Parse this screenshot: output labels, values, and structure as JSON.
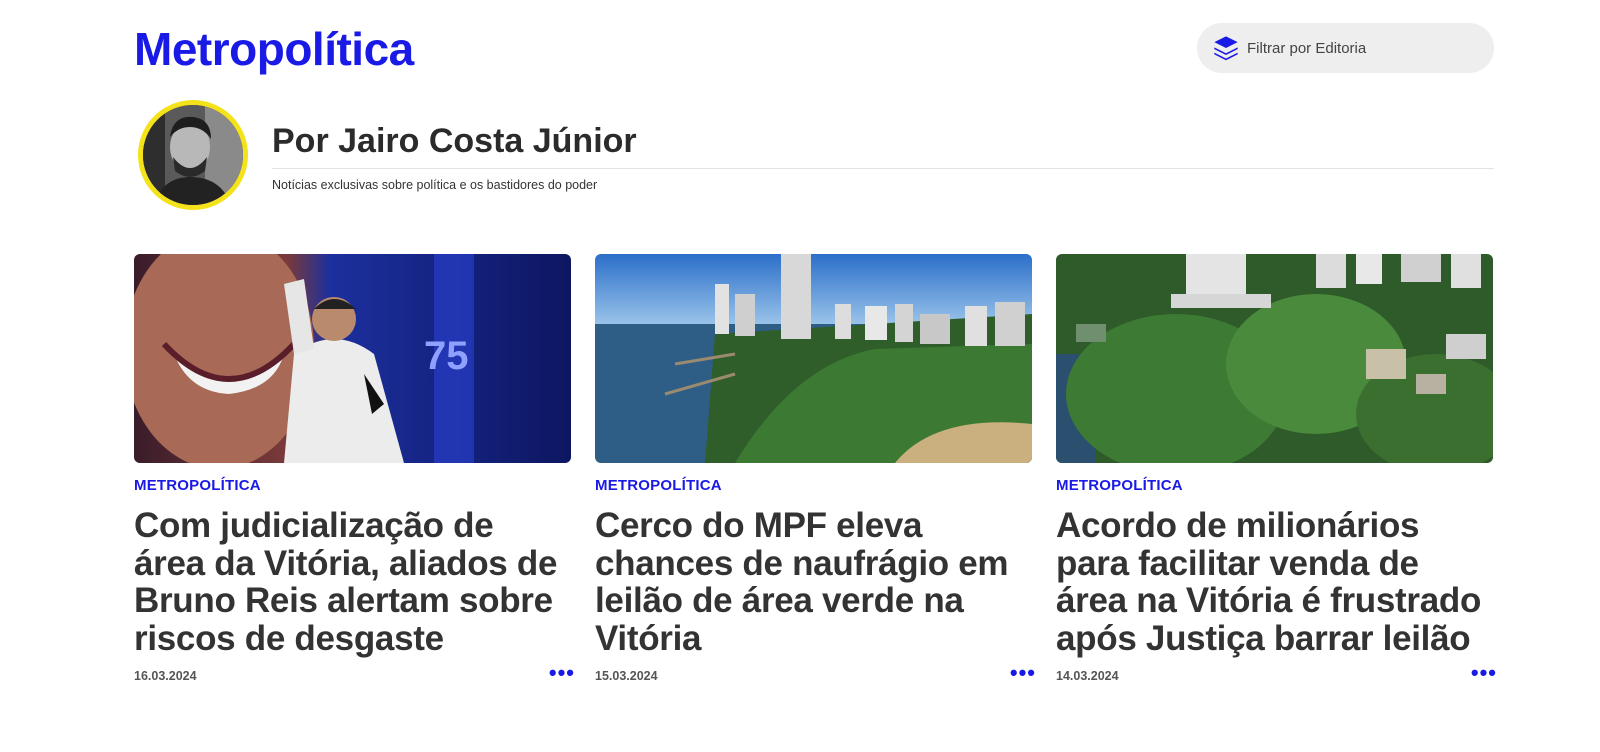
{
  "header": {
    "brand": "Metropolítica",
    "filter_label": "Filtrar por Editoria",
    "filter_icon": "layers-icon"
  },
  "author": {
    "name": "Por Jairo Costa Júnior",
    "description": "Notícias exclusivas sobre política e os bastidores do poder"
  },
  "articles": [
    {
      "category": "METROPOLÍTICA",
      "title": "Com judicialização de área da Vitória, aliados de Bruno Reis alertam sobre riscos de desgaste",
      "date": "16.03.2024",
      "more": "•••"
    },
    {
      "category": "METROPOLÍTICA",
      "title": "Cerco do MPF eleva chances de naufrágio em leilão de área verde na Vitória",
      "date": "15.03.2024",
      "more": "•••"
    },
    {
      "category": "METROPOLÍTICA",
      "title": "Acordo de milionários para facilitar venda de área na Vitória é frustrado após Justiça barrar leilão",
      "date": "14.03.2024",
      "more": "•••"
    }
  ],
  "colors": {
    "accent": "#1a1ae6",
    "avatar_ring": "#f4e21a",
    "text": "#333333"
  }
}
